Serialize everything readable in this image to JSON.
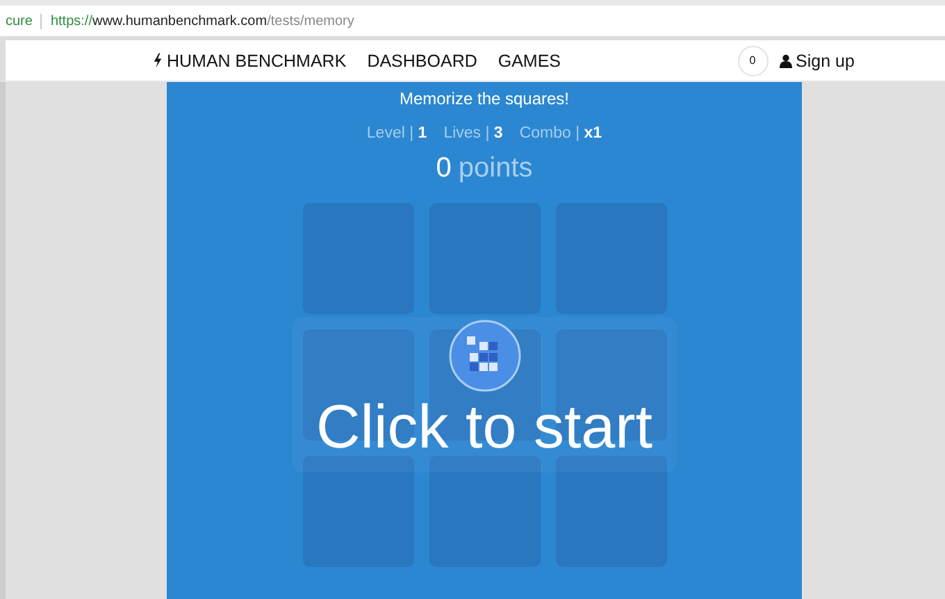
{
  "address_bar": {
    "security": "cure",
    "scheme": "https://",
    "host": "www.humanbenchmark.com",
    "path": "/tests/memory"
  },
  "nav": {
    "brand": "HUMAN BENCHMARK",
    "links": [
      "DASHBOARD",
      "GAMES"
    ],
    "count": "0",
    "signup": "Sign up"
  },
  "test": {
    "instruction": "Memorize the squares!",
    "stats": [
      "Level | **1**",
      "Lives | **3**",
      "Combo | **x1**"
    ],
    "score": {
      "value": "0",
      "unit": "points"
    },
    "start": "Click to start"
  }
}
